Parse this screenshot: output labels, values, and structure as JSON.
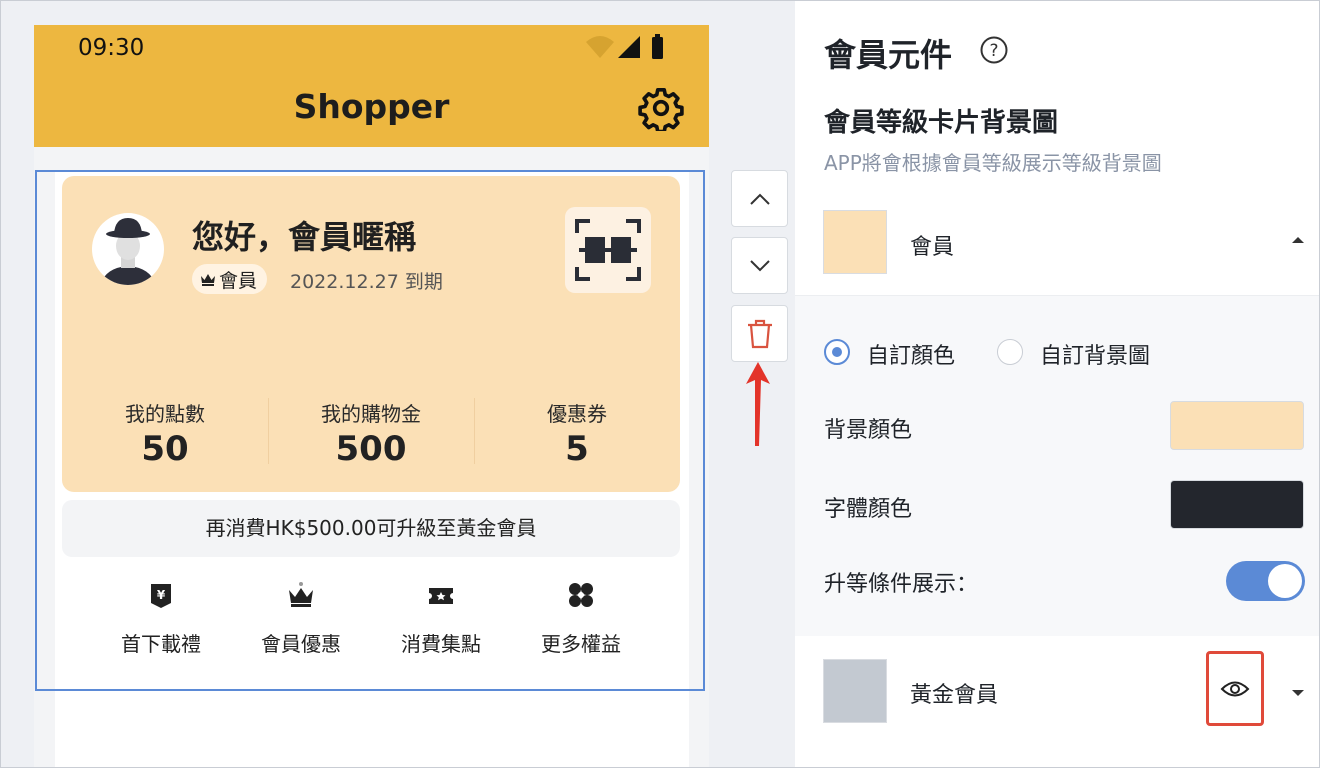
{
  "phone": {
    "status_time": "09:30",
    "app_title": "Shopper",
    "card": {
      "greeting": "您好，會員暱稱",
      "level_badge": "會員",
      "expiry": "2022.12.27 到期",
      "stats": [
        {
          "label": "我的點數",
          "value": "50"
        },
        {
          "label": "我的購物金",
          "value": "500"
        },
        {
          "label": "優惠券",
          "value": "5"
        }
      ],
      "background_color": "#fbe0b6"
    },
    "upgrade_text": "再消費HK$500.00可升級至黃金會員",
    "benefits": [
      {
        "label": "首下載禮",
        "icon": "yen-badge-icon"
      },
      {
        "label": "會員優惠",
        "icon": "crown-icon"
      },
      {
        "label": "消費集點",
        "icon": "ticket-icon"
      },
      {
        "label": "更多權益",
        "icon": "grid-more-icon"
      }
    ],
    "accent_color": "#edb740"
  },
  "controls": {
    "move_up": "chevron-up-icon",
    "move_down": "chevron-down-icon",
    "delete": "trash-icon"
  },
  "panel": {
    "title": "會員元件",
    "section_title": "會員等級卡片背景圖",
    "section_sub": "APP將會根據會員等級展示等級背景圖",
    "levels": [
      {
        "name": "會員",
        "swatch": "#fbe0b6",
        "expanded": true
      },
      {
        "name": "黃金會員",
        "swatch": "#c3c9d1",
        "expanded": false
      }
    ],
    "radio_custom_color": "自訂顏色",
    "radio_custom_bg": "自訂背景圖",
    "bg_color_label": "背景顏色",
    "font_color_label": "字體顏色",
    "upgrade_display_label": "升等條件展示：",
    "bg_color_value": "#fbe0b6",
    "font_color_value": "#23262d",
    "upgrade_display_on": true
  }
}
